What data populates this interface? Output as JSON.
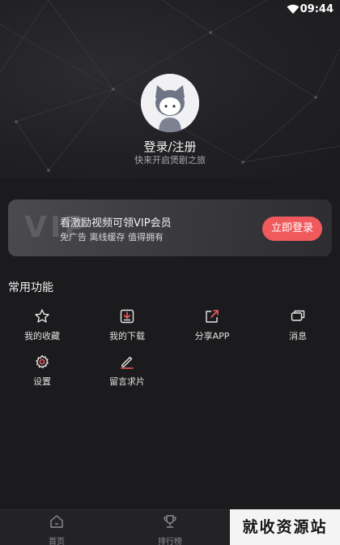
{
  "status": {
    "time": "09:44"
  },
  "profile": {
    "login_label": "登录/注册",
    "tagline": "快来开启煲剧之旅"
  },
  "vip": {
    "watermark": "VIP",
    "title": "看激励视频可领VIP会员",
    "subtitle": "免广告 离线缓存 值得拥有",
    "button": "立即登录",
    "accent": "#f05a5c"
  },
  "functions": {
    "title": "常用功能",
    "items": [
      {
        "label": "我的收藏",
        "icon": "star-icon"
      },
      {
        "label": "我的下载",
        "icon": "download-icon"
      },
      {
        "label": "分享APP",
        "icon": "share-icon"
      },
      {
        "label": "消息",
        "icon": "message-icon"
      },
      {
        "label": "设置",
        "icon": "gear-icon"
      },
      {
        "label": "留言求片",
        "icon": "edit-icon"
      }
    ]
  },
  "tabbar": {
    "items": [
      {
        "label": "首页",
        "icon": "home-icon"
      },
      {
        "label": "排行榜",
        "icon": "trophy-icon"
      }
    ]
  },
  "watermark": "就收资源站"
}
